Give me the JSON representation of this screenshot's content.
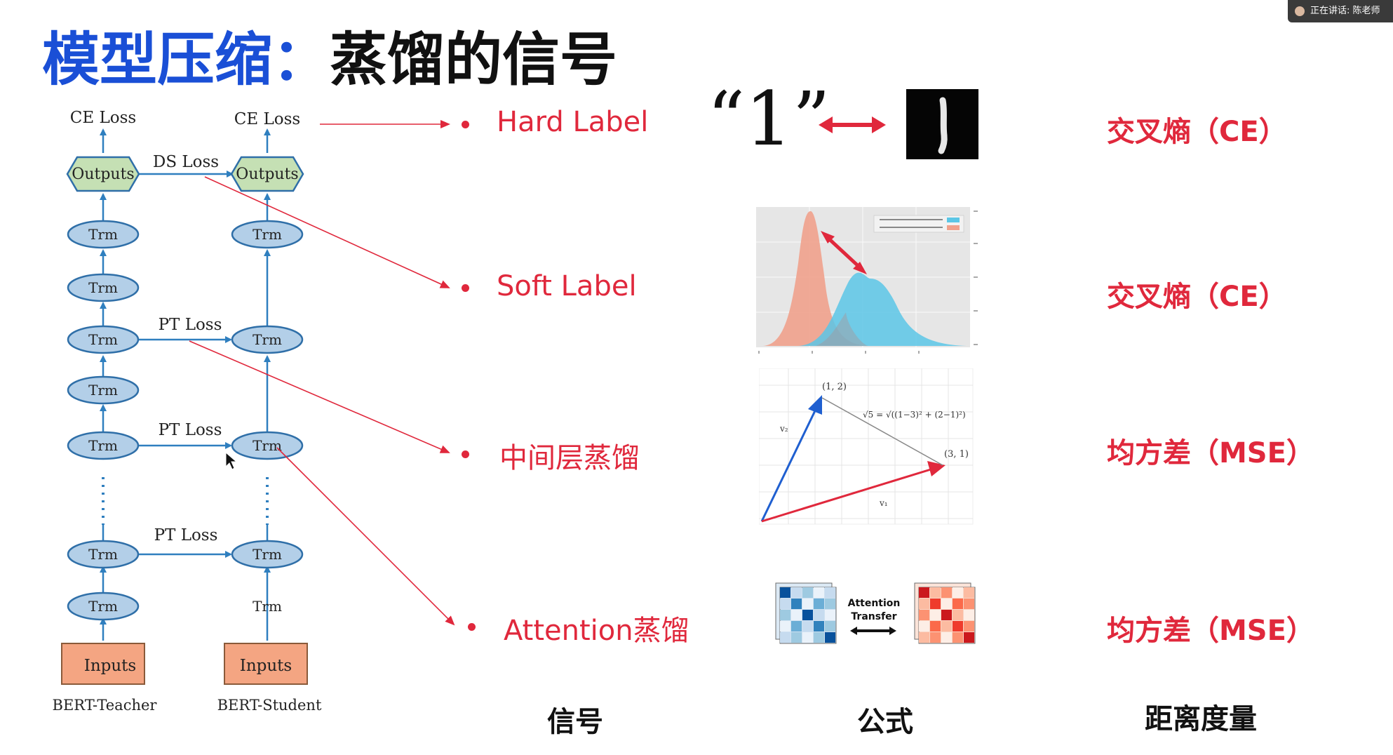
{
  "title": {
    "main": "模型压缩",
    "colon": "：",
    "rest": "蒸馏的信号"
  },
  "speaker_badge": {
    "text": "正在讲话: 陈老师"
  },
  "bert_diagram": {
    "teacher_label": "BERT-Teacher",
    "student_label": "BERT-Student",
    "ce_loss": "CE Loss",
    "ds_loss": "DS Loss",
    "pt_loss": "PT Loss",
    "outputs": "Outputs",
    "inputs": "Inputs",
    "trm": "Trm"
  },
  "signals": [
    {
      "label": "Hard Label",
      "metric": "交叉熵（CE）"
    },
    {
      "label": "Soft Label",
      "metric": "交叉熵（CE）"
    },
    {
      "label": "中间层蒸馏",
      "metric": "均方差（MSE）"
    },
    {
      "label": "Attention蒸馏",
      "metric": "均方差（MSE）"
    }
  ],
  "hard_label_symbol": "“1”",
  "attention_transfer": {
    "line1": "Attention",
    "line2": "Transfer"
  },
  "vector_plot": {
    "point_a": "(1, 2)",
    "point_b": "(3, 1)",
    "formula": "√5 = √((1−3)² + (2−1)²)",
    "v1": "v₁",
    "v2": "v₂"
  },
  "column_headers": {
    "signal": "信号",
    "formula": "公式",
    "metric": "距离度量"
  },
  "colors": {
    "title_blue": "#1a4fd6",
    "accent_red": "#e0283c",
    "node_fill": "#b3cfe8",
    "node_stroke": "#2f6fa8",
    "outputs_fill": "#c5e0b4",
    "inputs_fill": "#f4a582",
    "arrow_blue": "#2f7fbf",
    "hist_salmon": "#f0a18c",
    "hist_cyan": "#5bc6e6"
  }
}
